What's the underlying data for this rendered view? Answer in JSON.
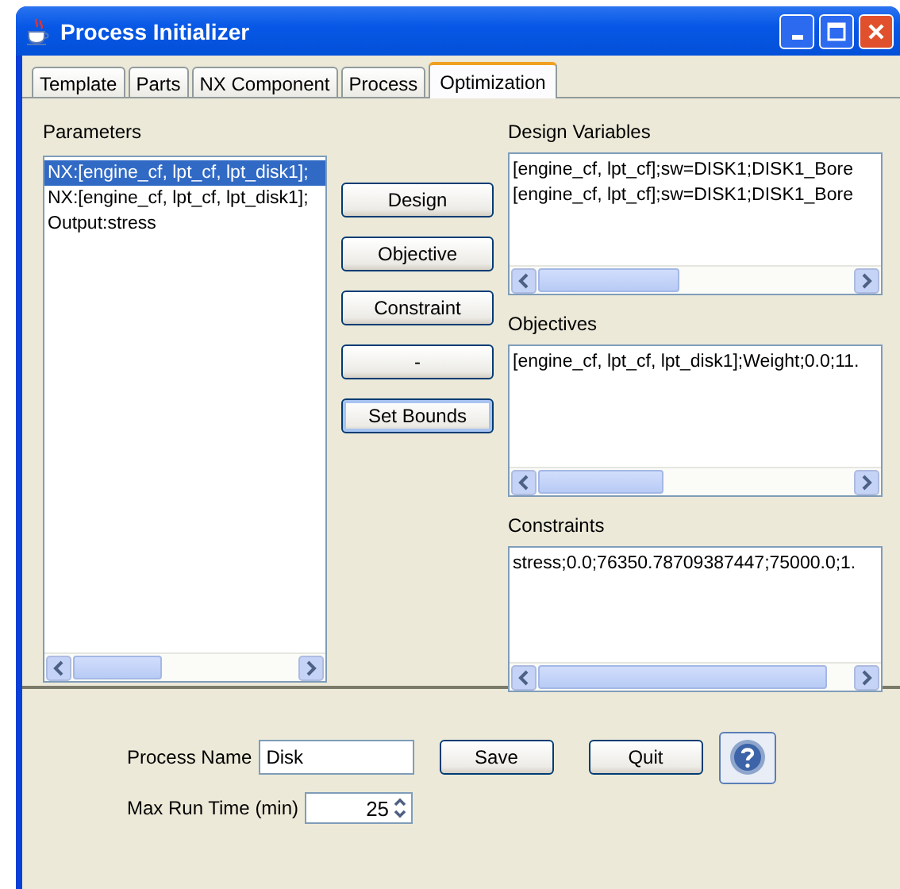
{
  "window": {
    "title": "Process Initializer"
  },
  "tabs": [
    {
      "label": "Template",
      "selected": false
    },
    {
      "label": "Parts",
      "selected": false
    },
    {
      "label": "NX Component",
      "selected": false
    },
    {
      "label": "Process",
      "selected": false
    },
    {
      "label": "Optimization",
      "selected": true
    }
  ],
  "parameters": {
    "label": "Parameters",
    "items": [
      {
        "text": "NX:[engine_cf, lpt_cf, lpt_disk1];",
        "selected": true
      },
      {
        "text": "NX:[engine_cf, lpt_cf, lpt_disk1];",
        "selected": false
      },
      {
        "text": "Output:stress",
        "selected": false
      }
    ]
  },
  "action_buttons": [
    "Design",
    "Objective",
    "Constraint",
    "-",
    "Set Bounds"
  ],
  "design_variables": {
    "label": "Design Variables",
    "items": [
      "[engine_cf, lpt_cf];sw=DISK1;DISK1_Bore",
      "[engine_cf, lpt_cf];sw=DISK1;DISK1_Bore"
    ]
  },
  "objectives": {
    "label": "Objectives",
    "items": [
      "[engine_cf, lpt_cf, lpt_disk1];Weight;0.0;11."
    ]
  },
  "constraints": {
    "label": "Constraints",
    "items": [
      "stress;0.0;76350.78709387447;75000.0;1."
    ]
  },
  "process_name": {
    "label": "Process Name",
    "value": "Disk"
  },
  "buttons": [
    "Save",
    "Quit"
  ],
  "max_run_time": {
    "label": "Max Run Time (min)",
    "value": "25"
  }
}
